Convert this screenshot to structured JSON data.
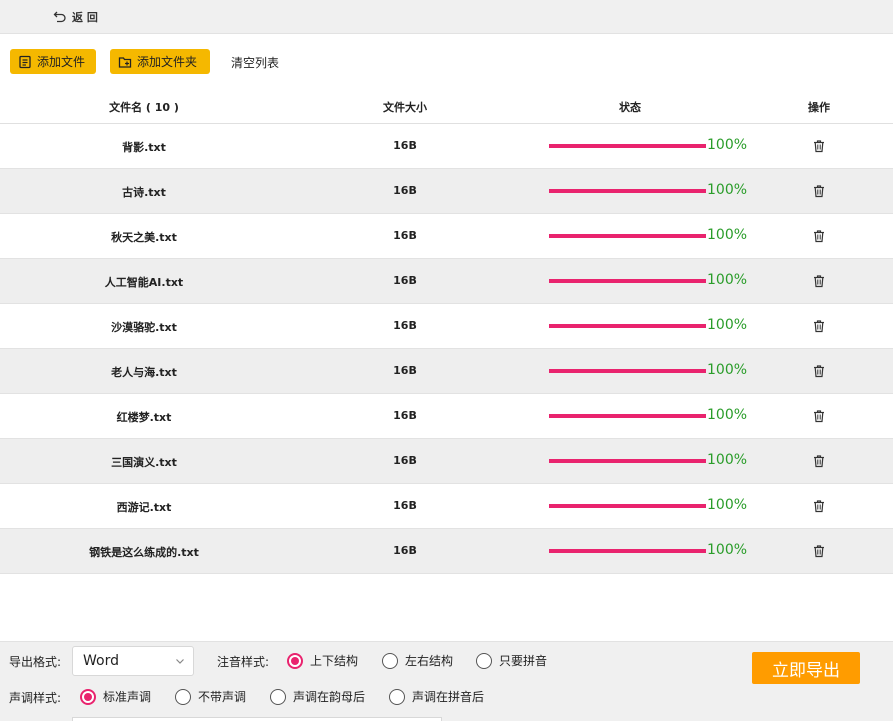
{
  "topbar": {
    "back_label": "返 回",
    "back_icon": "undo-arrow-icon"
  },
  "toolbar": {
    "add_file_label": "添加文件",
    "add_folder_label": "添加文件夹",
    "clear_label": "清空列表"
  },
  "table": {
    "columns": [
      "文件名 ( 10 )",
      "文件大小",
      "状态",
      "操作"
    ],
    "rows": [
      {
        "name": "背影.txt",
        "size": "16B",
        "progress": "100%"
      },
      {
        "name": "古诗.txt",
        "size": "16B",
        "progress": "100%"
      },
      {
        "name": "秋天之美.txt",
        "size": "16B",
        "progress": "100%"
      },
      {
        "name": "人工智能AI.txt",
        "size": "16B",
        "progress": "100%"
      },
      {
        "name": "沙漠骆驼.txt",
        "size": "16B",
        "progress": "100%"
      },
      {
        "name": "老人与海.txt",
        "size": "16B",
        "progress": "100%"
      },
      {
        "name": "红楼梦.txt",
        "size": "16B",
        "progress": "100%"
      },
      {
        "name": "三国演义.txt",
        "size": "16B",
        "progress": "100%"
      },
      {
        "name": "西游记.txt",
        "size": "16B",
        "progress": "100%"
      },
      {
        "name": "钢铁是这么练成的.txt",
        "size": "16B",
        "progress": "100%"
      }
    ]
  },
  "options": {
    "export_format_label": "导出格式:",
    "export_format_value": "Word",
    "phonetic_style_label": "注音样式:",
    "phonetic_options": [
      "上下结构",
      "左右结构",
      "只要拼音"
    ],
    "phonetic_selected": "上下结构",
    "tone_style_label": "声调样式:",
    "tone_options": [
      "标准声调",
      "不带声调",
      "声调在韵母后",
      "声调在拼音后"
    ],
    "tone_selected": "标准声调",
    "export_button_label": "立即导出"
  },
  "colors": {
    "accent_yellow": "#f5b800",
    "progress_pink": "#e9236e",
    "percent_green": "#2a9d2a",
    "export_orange": "#ff9c00"
  }
}
